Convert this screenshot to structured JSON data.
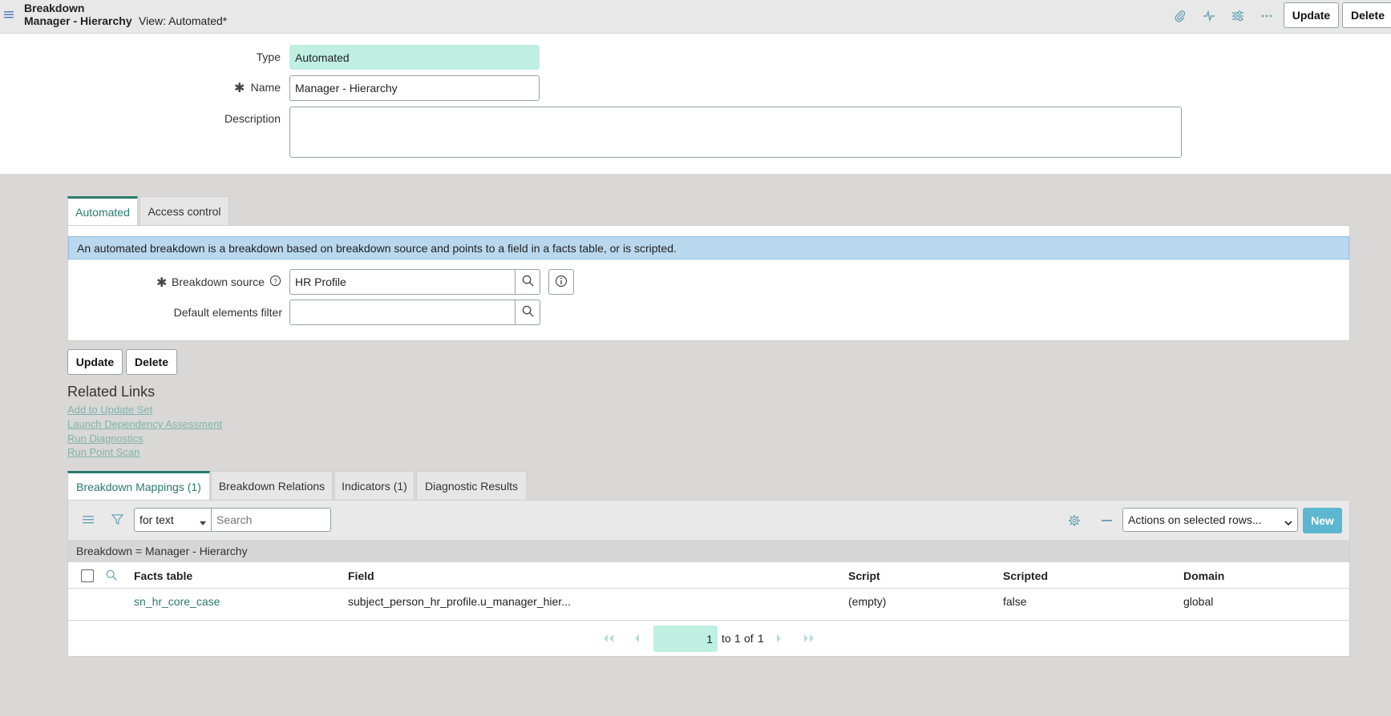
{
  "header": {
    "title_line1": "Breakdown",
    "title_line2": "Manager - Hierarchy",
    "view_label": "View: Automated*",
    "update_label": "Update",
    "delete_label": "Delete"
  },
  "form": {
    "type_label": "Type",
    "type_value": "Automated",
    "name_label": "Name",
    "name_value": "Manager - Hierarchy",
    "description_label": "Description",
    "description_value": ""
  },
  "section_tabs": [
    {
      "label": "Automated",
      "active": true
    },
    {
      "label": "Access control",
      "active": false
    }
  ],
  "automated": {
    "info_text": "An automated breakdown is a breakdown based on breakdown source and points to a field in a facts table, or is scripted.",
    "source_label": "Breakdown source",
    "source_value": "HR Profile",
    "filter_label": "Default elements filter",
    "filter_value": ""
  },
  "bottom_buttons": {
    "update_label": "Update",
    "delete_label": "Delete"
  },
  "related_links": {
    "title": "Related Links",
    "items": [
      "Add to Update Set",
      "Launch Dependency Assessment",
      "Run Diagnostics",
      "Run Point Scan"
    ]
  },
  "related_tabs": [
    {
      "label": "Breakdown Mappings (1)",
      "active": true
    },
    {
      "label": "Breakdown Relations",
      "active": false
    },
    {
      "label": "Indicators (1)",
      "active": false
    },
    {
      "label": "Diagnostic Results",
      "active": false
    }
  ],
  "list": {
    "search_type": "for text",
    "search_placeholder": "Search",
    "actions_label": "Actions on selected rows...",
    "new_label": "New",
    "condition": "Breakdown = Manager - Hierarchy",
    "columns": [
      "Facts table",
      "Field",
      "Script",
      "Scripted",
      "Domain"
    ],
    "rows": [
      [
        "sn_hr_core_case",
        "subject_person_hr_profile.u_manager_hier...",
        "(empty)",
        "false",
        "global"
      ]
    ],
    "pager": {
      "current": "1",
      "to_text": "to",
      "end": "1",
      "of_text": "of",
      "total": "1"
    }
  },
  "colors": {
    "accent": "#2a7a6e",
    "readonly_bg": "#bfefe0",
    "info_bg": "#b9d8ee",
    "new_button": "#5cb6cf",
    "link_muted": "#7fb3a8"
  }
}
